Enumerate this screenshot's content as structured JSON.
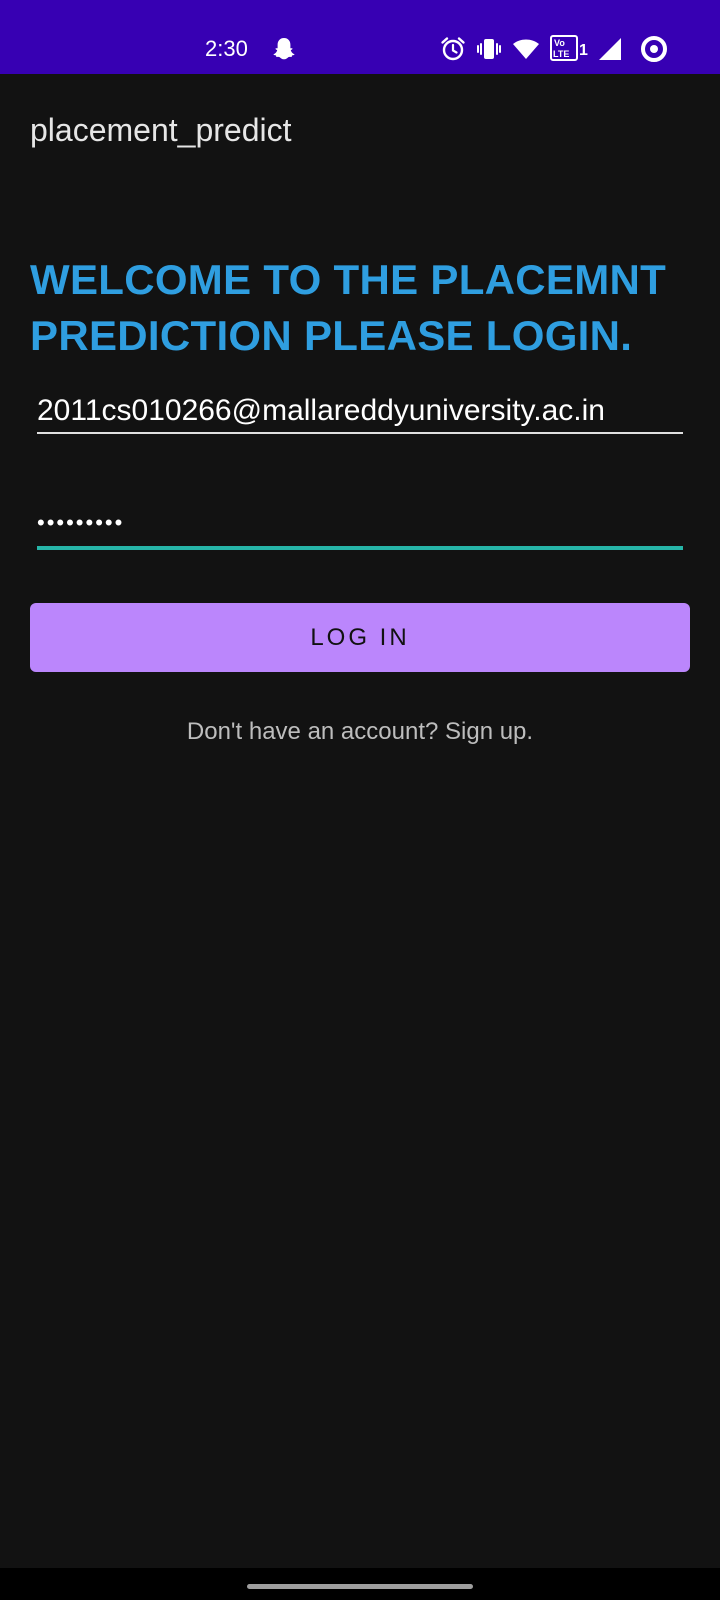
{
  "status_bar": {
    "time": "2:30",
    "icons": [
      "snapchat-icon",
      "alarm-icon",
      "vibrate-icon",
      "wifi-icon",
      "volte-icon",
      "signal-icon",
      "circle-icon"
    ],
    "background": "#3700b3"
  },
  "app_bar": {
    "title": "placement_predict"
  },
  "login": {
    "welcome_text": "WELCOME TO THE PLACEMNT PREDICTION PLEASE LOGIN.",
    "email_value": "2011cs010266@mallareddyuniversity.ac.in",
    "password_value": "•••••••••",
    "login_button_label": "LOG IN",
    "signup_text": "Don't have an account? Sign up."
  },
  "colors": {
    "background": "#121212",
    "heading": "#2f9ee0",
    "button": "#bb86fc",
    "focus_underline": "#26b5a8"
  }
}
